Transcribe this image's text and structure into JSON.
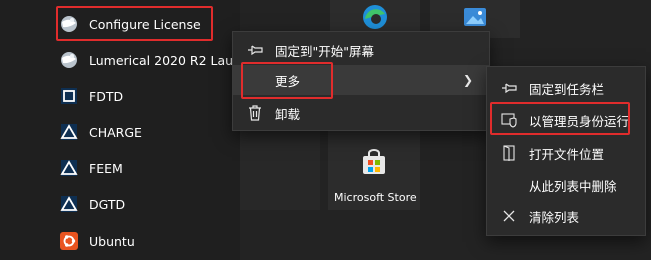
{
  "start_list": {
    "items": [
      {
        "label": "Configure License",
        "icon": "lumerical-globe-icon"
      },
      {
        "label": "Lumerical 2020 R2 Laun",
        "icon": "lumerical-globe-icon"
      },
      {
        "label": "FDTD",
        "icon": "fdtd-icon"
      },
      {
        "label": "CHARGE",
        "icon": "charge-triangle-icon"
      },
      {
        "label": "FEEM",
        "icon": "feem-triangle-icon"
      },
      {
        "label": "DGTD",
        "icon": "dgtd-triangle-icon"
      },
      {
        "label": "Ubuntu",
        "icon": "ubuntu-icon"
      }
    ]
  },
  "tiles": {
    "store_label": "Microsoft Store"
  },
  "context_menu": {
    "pin_start": "固定到\"开始\"屏幕",
    "more": "更多",
    "uninstall": "卸载"
  },
  "submenu": {
    "pin_taskbar": "固定到任务栏",
    "run_as_admin": "以管理员身份运行",
    "open_location": "打开文件位置",
    "remove_from_list": "从此列表中删除",
    "clear_list": "清除列表"
  },
  "colors": {
    "highlight_box": "#e02c2c",
    "menu_bg": "#2b2b2b",
    "accent_blue": "#3fa9f5",
    "ubuntu_orange": "#e95420"
  }
}
